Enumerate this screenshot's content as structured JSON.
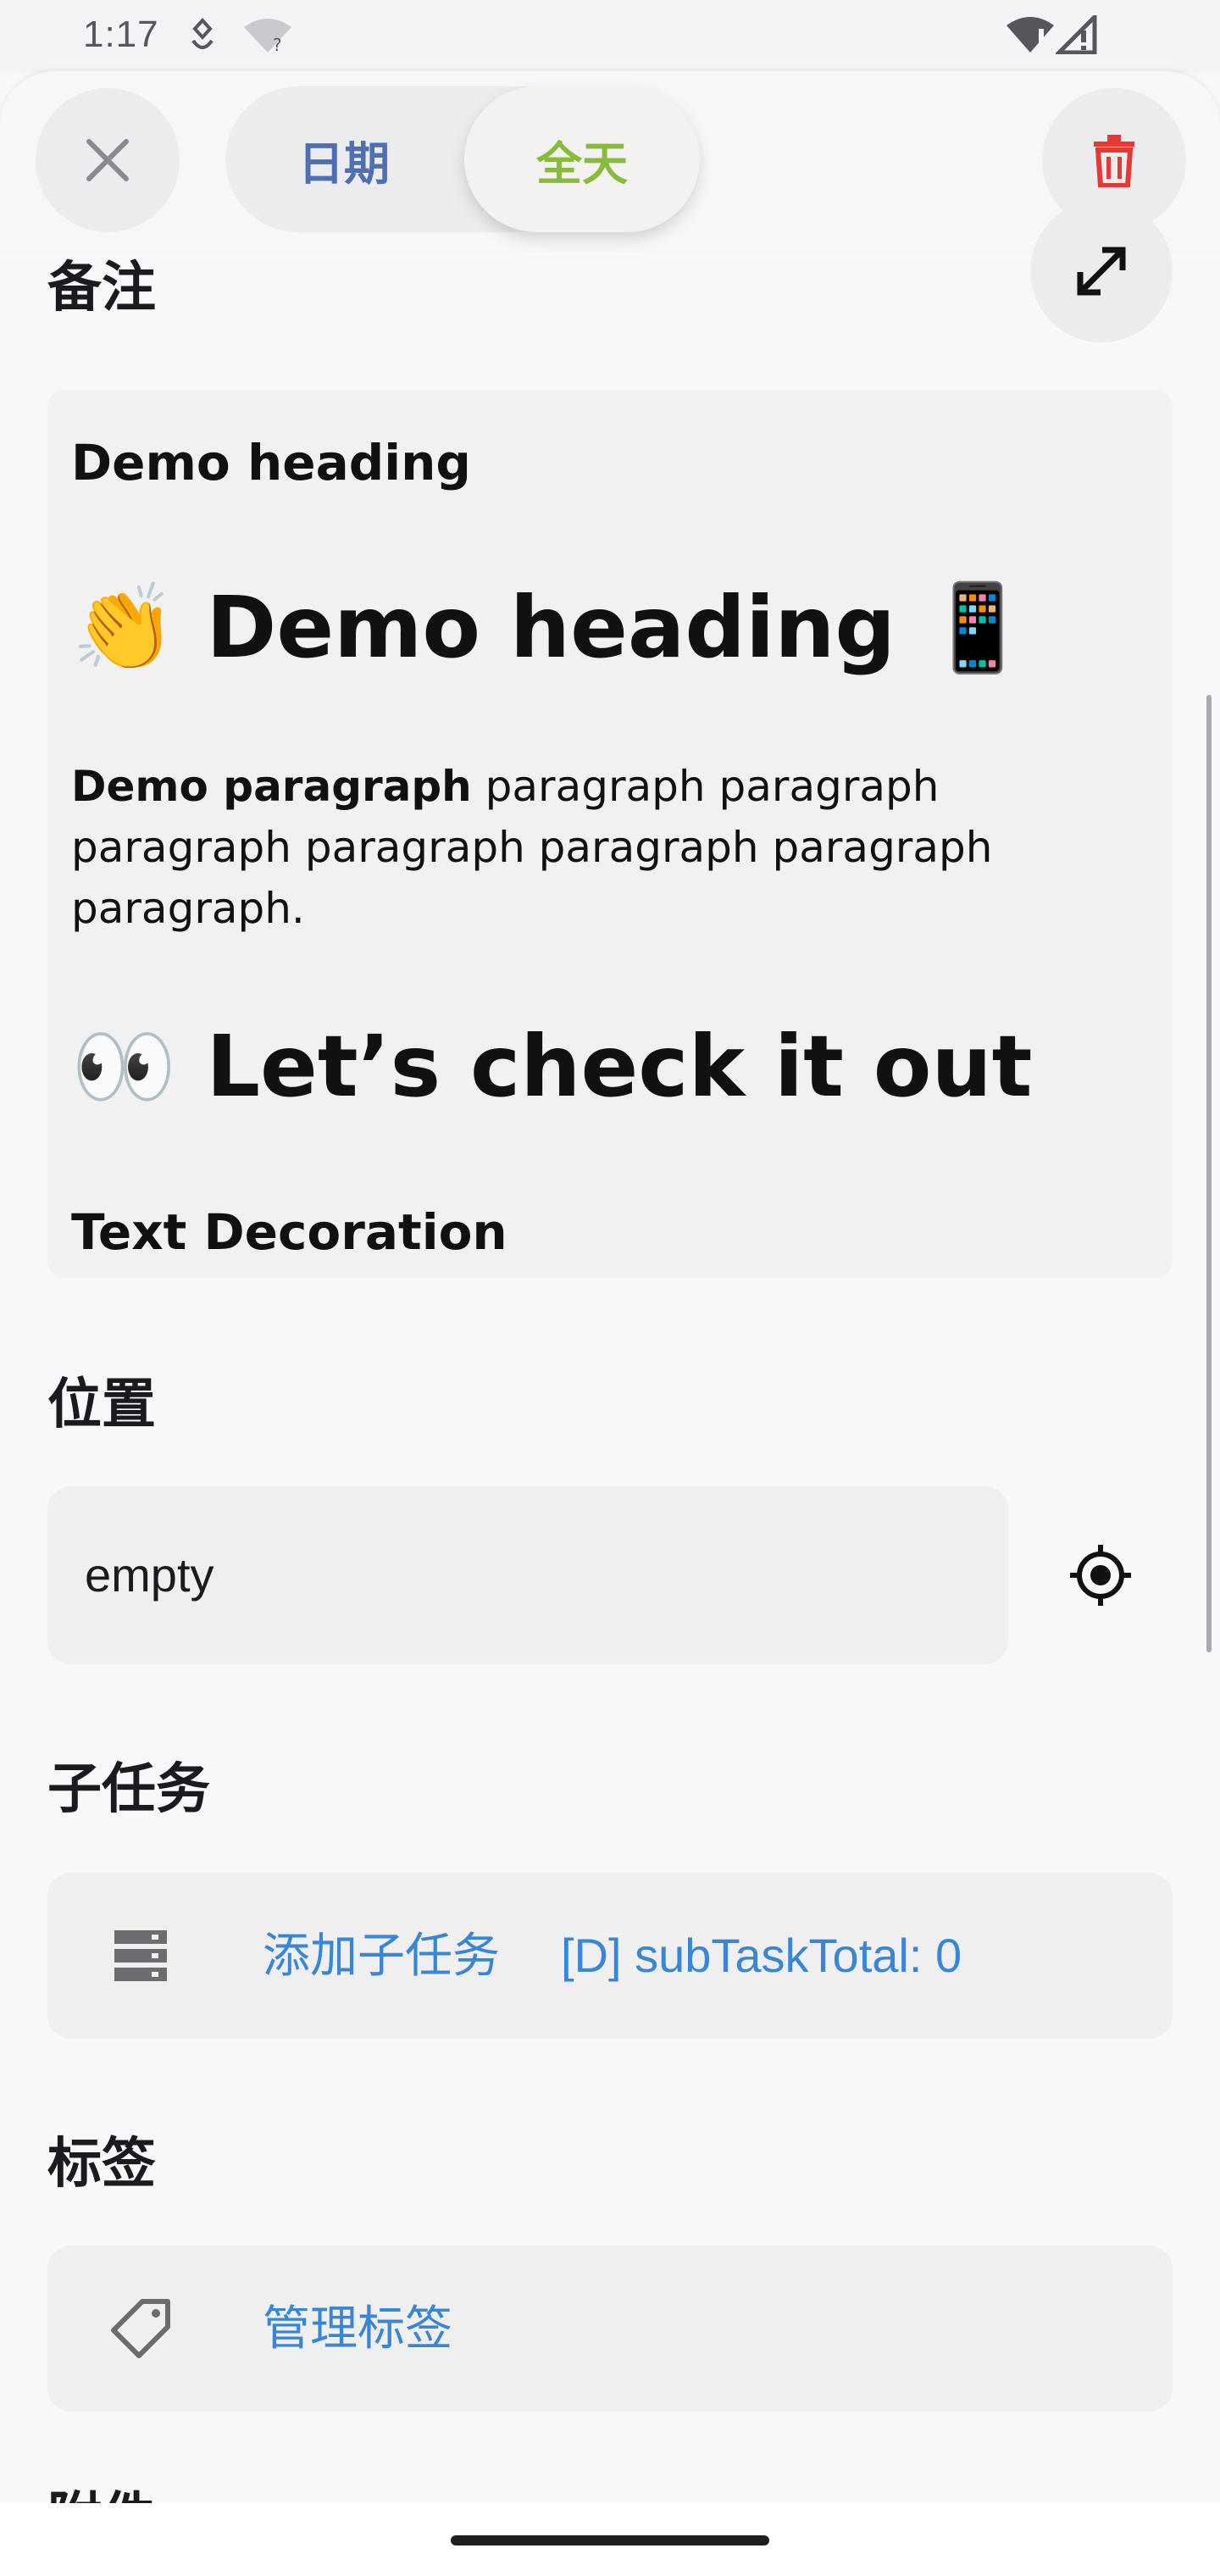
{
  "status_bar": {
    "time": "1:17",
    "icons_left": [
      "android-debug-icon",
      "wifi-unknown-icon"
    ],
    "icons_right": [
      "wifi-alert-icon",
      "signal-alert-icon"
    ]
  },
  "top_bar": {
    "close_icon": "close-icon",
    "tabs": [
      {
        "label": "日期",
        "selected": false,
        "color": "#4f6fb0"
      },
      {
        "label": "全天",
        "selected": true,
        "color": "#86bb3c"
      }
    ],
    "delete_icon": "trash-icon",
    "delete_color": "#e53935"
  },
  "notes": {
    "title": "备注",
    "expand_icon": "expand-icon",
    "content": {
      "heading1": "Demo heading",
      "heading2": "👏 Demo heading 📱",
      "paragraph_bold": "Demo paragraph",
      "paragraph_rest": "  paragraph paragraph paragraph paragraph paragraph paragraph paragraph.",
      "heading3": "👀 Let’s check it out",
      "heading4": "Text Decoration"
    }
  },
  "location": {
    "title": "位置",
    "value": "empty",
    "locate_icon": "gps-crosshair-icon"
  },
  "subtasks": {
    "title": "子任务",
    "icon": "list-stack-icon",
    "add_label": "添加子任务",
    "debug_label": "[D] subTaskTotal: 0"
  },
  "tags": {
    "title": "标签",
    "icon": "tag-icon",
    "manage_label": "管理标签"
  },
  "next_section_partial": "附件",
  "colors": {
    "link": "#3a86d6",
    "background": "#f7f8fa",
    "card": "#efefef"
  }
}
